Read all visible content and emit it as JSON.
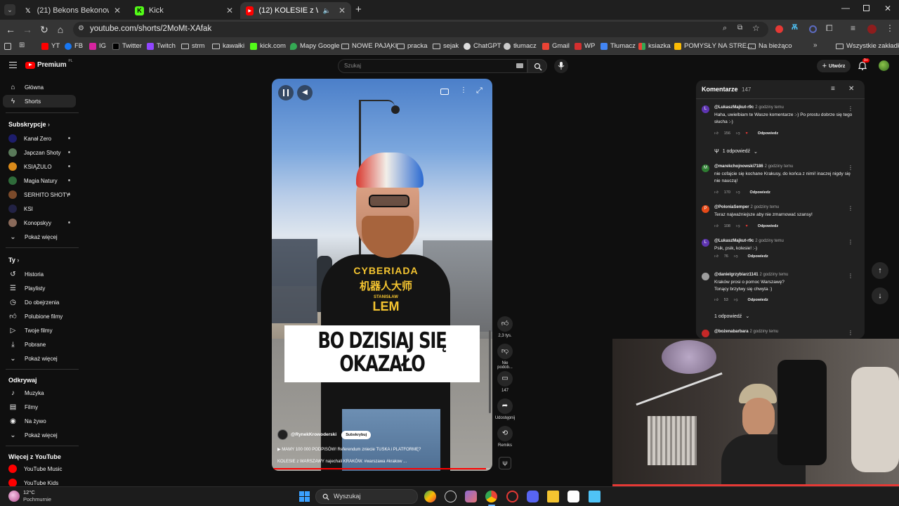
{
  "browser": {
    "tabs": [
      {
        "title": "(21) Bekons Bekonowy w serwi",
        "favicon": "x-icon",
        "active": false
      },
      {
        "title": "Kick",
        "favicon": "kick-icon",
        "active": false
      },
      {
        "title": "(12) KOLESIE z WARSZAWY",
        "favicon": "youtube-icon",
        "active": true
      }
    ],
    "url": "youtube.com/shorts/2MoMt-XAfak",
    "bookmarks": [
      "YT",
      "FB",
      "IG",
      "Twitter",
      "Twitch",
      "strm",
      "kawałki",
      "kick.com",
      "Mapy Google",
      "NOWE PAJĄKI",
      "pracka",
      "sejak",
      "ChatGPT",
      "tłumacz",
      "Gmail",
      "WP",
      "Tłumacz",
      "ksiazka",
      "POMYSŁY NA STRE...",
      "Na bieżąco",
      "Wszystkie zakładki"
    ]
  },
  "youtube": {
    "logo": "Premium",
    "logo_region": "PL",
    "search_placeholder": "Szukaj",
    "create_label": "Utwórz",
    "notif_count": "9+",
    "sidebar": {
      "main": [
        {
          "label": "Główna",
          "icon": "home-icon"
        },
        {
          "label": "Shorts",
          "icon": "shorts-icon"
        }
      ],
      "subs_heading": "Subskrypcje",
      "subs": [
        {
          "label": "Kanał Zero",
          "color": "#1d1d6b",
          "dot": true
        },
        {
          "label": "Japczan Shoty",
          "color": "#5a7a5a",
          "dot": true
        },
        {
          "label": "KSIĄŻULO",
          "color": "#d98a1a",
          "dot": true
        },
        {
          "label": "Magia Natury",
          "color": "#2f6b3a",
          "dot": true
        },
        {
          "label": "SERHITO SHOTY",
          "color": "#7b4a2a",
          "dot": true
        },
        {
          "label": "KSI",
          "color": "#222244",
          "dot": false
        },
        {
          "label": "Konopskyy",
          "color": "#8a6a5a",
          "dot": true
        },
        {
          "label": "Pokaż więcej",
          "color": "",
          "dot": false
        }
      ],
      "you_heading": "Ty",
      "you": [
        "Historia",
        "Playlisty",
        "Do obejrzenia",
        "Polubione filmy",
        "Twoje filmy",
        "Pobrane",
        "Pokaż więcej"
      ],
      "explore_heading": "Odkrywaj",
      "explore": [
        "Muzyka",
        "Filmy",
        "Na żywo",
        "Pokaż więcej"
      ],
      "more_heading": "Więcej z YouTube",
      "more": [
        "YouTube Music",
        "YouTube Kids"
      ]
    },
    "short": {
      "caption_line1": "BO DZISIAJ SIĘ",
      "caption_line2": "OKAZAŁO",
      "channel": "@RynekKrowoderski",
      "subscribe": "Subskrybuj",
      "title_line1": "▶ MAMY 100 000 PODPISÓW! Referendum zniecie TUSKA i PLATFORMĘ?",
      "title_line2": "KOLESIE z WARSZAWY najechali KRAKÓW. #warszawa #krakow ...",
      "shirt_line1": "CYBERIADA",
      "shirt_line2": "机器人大师",
      "shirt_line3": "STANISŁAW",
      "shirt_line4": "LEM",
      "progress": 0.97
    },
    "actions": {
      "likes": "2,3 tys.",
      "dislike": "Nie podob...",
      "comments": "147",
      "share": "Udostępnij",
      "remix": "Remiks"
    },
    "comments_panel": {
      "title": "Komentarze",
      "count": "147",
      "items": [
        {
          "author": "@LukaszMajkut-r9c",
          "time": "2 godziny temu",
          "avatar": "L",
          "color": "#5e35b1",
          "text": "Haha, uwielbiam te Wasze komentarze :-) Po prostu dobrze się tego słucha :-)",
          "likes": "156",
          "reply_label": "Odpowiedz",
          "replies": "1 odpowiedź"
        },
        {
          "author": "@marekchojnowski7186",
          "time": "2 godziny temu",
          "avatar": "M",
          "color": "#2e7d32",
          "text": "nie cofajcie się kochane Krakusy, do końca z nimi! inaczej nigdy się nie nauczą!",
          "likes": "170",
          "reply_label": "Odpowiedz",
          "replies": ""
        },
        {
          "author": "@PoloniaSemper",
          "time": "2 godziny temu",
          "avatar": "P",
          "color": "#e64a19",
          "text": "Teraz najważniejsze aby nie zmarnować szansy!",
          "likes": "108",
          "reply_label": "Odpowiedz",
          "replies": ""
        },
        {
          "author": "@LukaszMajkut-r9c",
          "time": "2 godziny temu",
          "avatar": "L",
          "color": "#5e35b1",
          "text": "Psik, psik, kolesie! :-)",
          "likes": "76",
          "reply_label": "Odpowiedz",
          "replies": ""
        },
        {
          "author": "@danielgrzybiarz1141",
          "time": "2 godziny temu",
          "avatar": "",
          "color": "#9e9e9e",
          "text": "Kraków prosi o pomoc Warszawę? Tonący brzytwy się chwyta :)",
          "likes": "53",
          "reply_label": "Odpowiedz",
          "replies": "1 odpowiedź"
        },
        {
          "author": "@bożenabarbara",
          "time": "2 godziny temu",
          "avatar": "",
          "color": "#c62828",
          "text": "",
          "likes": "",
          "reply_label": "",
          "replies": ""
        }
      ]
    }
  },
  "taskbar": {
    "weather_temp": "12°C",
    "weather_desc": "Pochmurnie",
    "search_label": "Wyszukaj"
  }
}
